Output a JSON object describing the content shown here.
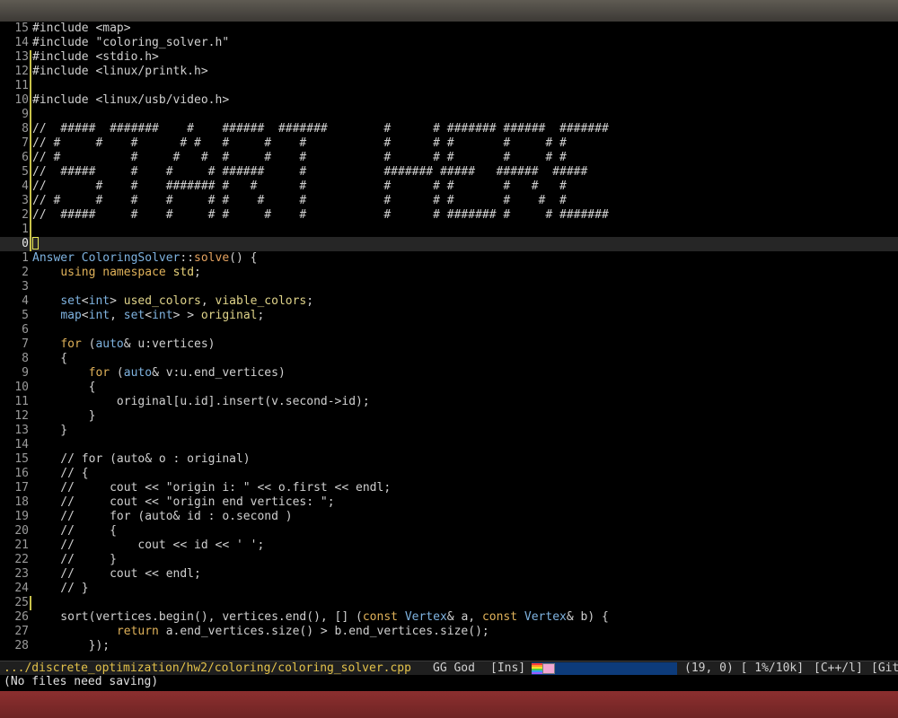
{
  "colors": {
    "titlebar": "#4a4742",
    "background": "#000000",
    "modified_marker": "#c9c24a",
    "type": "#7fb3e0",
    "keyword": "#e0b25a",
    "path": "#e3c24a",
    "nyan_bar": "#0d3b7a",
    "desktop": "#7a2a2a"
  },
  "lines": [
    {
      "num": "15",
      "text": "#include <map>"
    },
    {
      "num": "14",
      "text": "#include \"coloring_solver.h\""
    },
    {
      "num": "13",
      "text": "#include <stdio.h>",
      "marked": true
    },
    {
      "num": "12",
      "text": "#include <linux/printk.h>",
      "marked": true
    },
    {
      "num": "11",
      "text": "",
      "marked": true
    },
    {
      "num": "10",
      "text": "#include <linux/usb/video.h>",
      "marked": true
    },
    {
      "num": "9",
      "text": "",
      "marked": true
    },
    {
      "num": "8",
      "text": "//  #####  #######    #    ######  #######        #      # ####### ######  #######",
      "marked": true
    },
    {
      "num": "7",
      "text": "// #     #    #      # #   #     #    #           #      # #       #     # #",
      "marked": true
    },
    {
      "num": "6",
      "text": "// #          #     #   #  #     #    #           #      # #       #     # #",
      "marked": true
    },
    {
      "num": "5",
      "text": "//  #####     #    #     # ######     #           ####### #####   ######  #####",
      "marked": true
    },
    {
      "num": "4",
      "text": "//       #    #    ####### #   #      #           #      # #       #   #   #",
      "marked": true
    },
    {
      "num": "3",
      "text": "// #     #    #    #     # #    #     #           #      # #       #    #  #",
      "marked": true
    },
    {
      "num": "2",
      "text": "//  #####     #    #     # #     #    #           #      # ####### #     # #######",
      "marked": true
    },
    {
      "num": "1",
      "text": "",
      "marked": true
    },
    {
      "num": "0",
      "text": "",
      "current": true,
      "marked": true
    },
    {
      "num": "1",
      "text": "Answer ColoringSolver::solve() {"
    },
    {
      "num": "2",
      "text": "    using namespace std;"
    },
    {
      "num": "3",
      "text": ""
    },
    {
      "num": "4",
      "text": "    set<int> used_colors, viable_colors;"
    },
    {
      "num": "5",
      "text": "    map<int, set<int> > original;"
    },
    {
      "num": "6",
      "text": ""
    },
    {
      "num": "7",
      "text": "    for (auto& u:vertices)"
    },
    {
      "num": "8",
      "text": "    {"
    },
    {
      "num": "9",
      "text": "        for (auto& v:u.end_vertices)"
    },
    {
      "num": "10",
      "text": "        {"
    },
    {
      "num": "11",
      "text": "            original[u.id].insert(v.second->id);"
    },
    {
      "num": "12",
      "text": "        }"
    },
    {
      "num": "13",
      "text": "    }"
    },
    {
      "num": "14",
      "text": ""
    },
    {
      "num": "15",
      "text": "    // for (auto& o : original)"
    },
    {
      "num": "16",
      "text": "    // {"
    },
    {
      "num": "17",
      "text": "    //     cout << \"origin i: \" << o.first << endl;"
    },
    {
      "num": "18",
      "text": "    //     cout << \"origin end vertices: \";"
    },
    {
      "num": "19",
      "text": "    //     for (auto& id : o.second )"
    },
    {
      "num": "20",
      "text": "    //     {"
    },
    {
      "num": "21",
      "text": "    //         cout << id << ' ';"
    },
    {
      "num": "22",
      "text": "    //     }"
    },
    {
      "num": "23",
      "text": "    //     cout << endl;"
    },
    {
      "num": "24",
      "text": "    // }"
    },
    {
      "num": "25",
      "text": "",
      "marked": true
    },
    {
      "num": "26",
      "text": "    sort(vertices.begin(), vertices.end(), [] (const Vertex& a, const Vertex& b) {"
    },
    {
      "num": "27",
      "text": "            return a.end_vertices.size() > b.end_vertices.size();"
    },
    {
      "num": "28",
      "text": "        });"
    }
  ],
  "modeline": {
    "path": ".../discrete_optimization/hw2/coloring/coloring_solver.cpp",
    "minor_modes": "GG God",
    "state": "[Ins]",
    "position": "(19, 0) [ 1%/10k]",
    "major_mode": "[C++/l]",
    "vcs": "[Git"
  },
  "echo": "(No files need saving)"
}
